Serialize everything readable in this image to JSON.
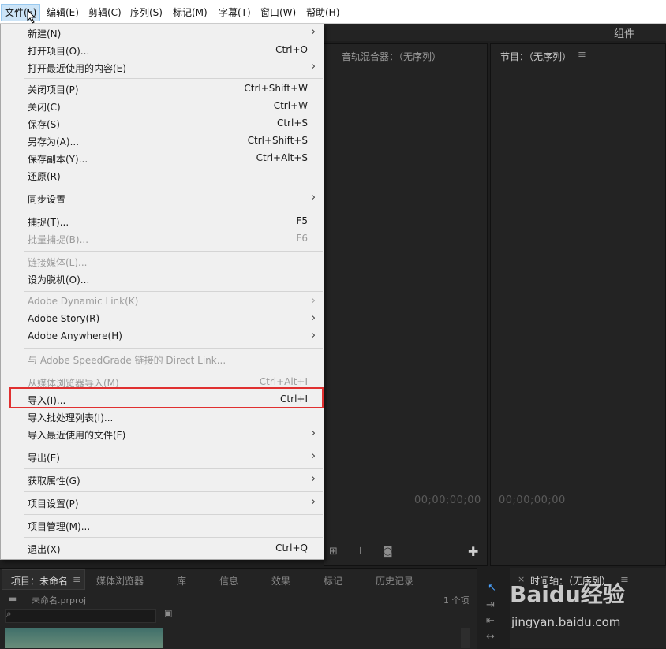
{
  "menubar": {
    "items": [
      {
        "label": "文件(F)",
        "active": true
      },
      {
        "label": "编辑(E)"
      },
      {
        "label": "剪辑(C)"
      },
      {
        "label": "序列(S)"
      },
      {
        "label": "标记(M)"
      },
      {
        "label": "字幕(T)"
      },
      {
        "label": "窗口(W)"
      },
      {
        "label": "帮助(H)"
      }
    ]
  },
  "workspace": {
    "label": "组件"
  },
  "panels": {
    "audio_mixer_title": "音轨混合器：（无序列）",
    "program_title": "节目：（无序列）",
    "source_timecode": "00;00;00;00",
    "program_timecode": "00;00;00;00"
  },
  "file_menu": {
    "items": [
      {
        "label": "新建(N)",
        "shortcut": "",
        "submenu": true
      },
      {
        "label": "打开项目(O)...",
        "shortcut": "Ctrl+O"
      },
      {
        "label": "打开最近使用的内容(E)",
        "shortcut": "",
        "submenu": true
      },
      {
        "label": "关闭项目(P)",
        "shortcut": "Ctrl+Shift+W"
      },
      {
        "label": "关闭(C)",
        "shortcut": "Ctrl+W"
      },
      {
        "label": "保存(S)",
        "shortcut": "Ctrl+S"
      },
      {
        "label": "另存为(A)...",
        "shortcut": "Ctrl+Shift+S"
      },
      {
        "label": "保存副本(Y)...",
        "shortcut": "Ctrl+Alt+S"
      },
      {
        "label": "还原(R)",
        "shortcut": ""
      },
      {
        "label": "同步设置",
        "shortcut": "",
        "submenu": true
      },
      {
        "label": "捕捉(T)...",
        "shortcut": "F5"
      },
      {
        "label": "批量捕捉(B)...",
        "shortcut": "F6",
        "disabled": true
      },
      {
        "label": "链接媒体(L)...",
        "shortcut": "",
        "disabled": true
      },
      {
        "label": "设为脱机(O)...",
        "shortcut": ""
      },
      {
        "label": "Adobe Dynamic Link(K)",
        "shortcut": "",
        "submenu": true,
        "disabled": true
      },
      {
        "label": "Adobe Story(R)",
        "shortcut": "",
        "submenu": true
      },
      {
        "label": "Adobe Anywhere(H)",
        "shortcut": "",
        "submenu": true
      },
      {
        "label": "与 Adobe SpeedGrade 链接的 Direct Link...",
        "shortcut": "",
        "disabled": true
      },
      {
        "label": "从媒体浏览器导入(M)",
        "shortcut": "Ctrl+Alt+I",
        "disabled": true
      },
      {
        "label": "导入(I)...",
        "shortcut": "Ctrl+I",
        "highlighted": true
      },
      {
        "label": "导入批处理列表(I)...",
        "shortcut": ""
      },
      {
        "label": "导入最近使用的文件(F)",
        "shortcut": "",
        "submenu": true
      },
      {
        "label": "导出(E)",
        "shortcut": "",
        "submenu": true
      },
      {
        "label": "获取属性(G)",
        "shortcut": "",
        "submenu": true
      },
      {
        "label": "项目设置(P)",
        "shortcut": "",
        "submenu": true
      },
      {
        "label": "项目管理(M)...",
        "shortcut": ""
      },
      {
        "label": "退出(X)",
        "shortcut": "Ctrl+Q"
      }
    ]
  },
  "project_panel": {
    "tabs": [
      "项目：未命名",
      "媒体浏览器",
      "库",
      "信息",
      "效果",
      "标记",
      "历史记录"
    ],
    "file_name": "未命名.prproj",
    "item_count": "1 个项"
  },
  "timeline": {
    "title": "时间轴：（无序列）"
  },
  "watermark": {
    "text": "Baidu经验",
    "url": "jingyan.baidu.com"
  },
  "colors": {
    "highlight_box": "#e03030",
    "menu_bg": "#f0f0f0",
    "panel_bg": "#232323"
  }
}
